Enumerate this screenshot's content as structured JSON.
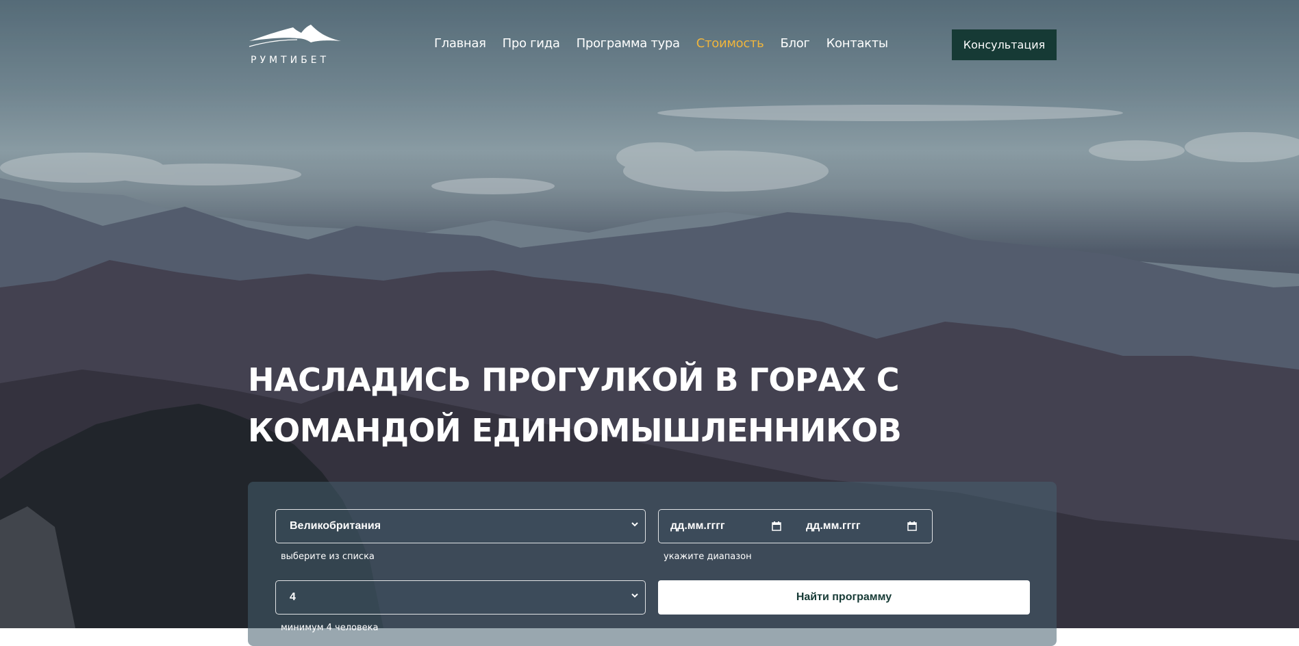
{
  "header": {
    "logo_text": "РУМТИБЕТ",
    "nav": [
      {
        "label": "Главная",
        "active": false
      },
      {
        "label": "Про гида",
        "active": false
      },
      {
        "label": "Программа тура",
        "active": false
      },
      {
        "label": "Стоимость",
        "active": true
      },
      {
        "label": "Блог",
        "active": false
      },
      {
        "label": "Контакты",
        "active": false
      }
    ],
    "cta_label": "Консультация"
  },
  "hero": {
    "title": "Насладись прогулкой в горах с командой единомышленников"
  },
  "search": {
    "country_value": "Великобритания",
    "country_hint": "выберите из списка",
    "date_from_placeholder": "дд.мм.гггг",
    "date_to_placeholder": "дд.мм.гггг",
    "dates_hint": "укажите диапазон",
    "people_value": "4",
    "people_hint": "минимум 4 человека",
    "submit_label": "Найти программу"
  },
  "colors": {
    "accent": "#f0b53c",
    "brand_dark": "#163a35"
  }
}
